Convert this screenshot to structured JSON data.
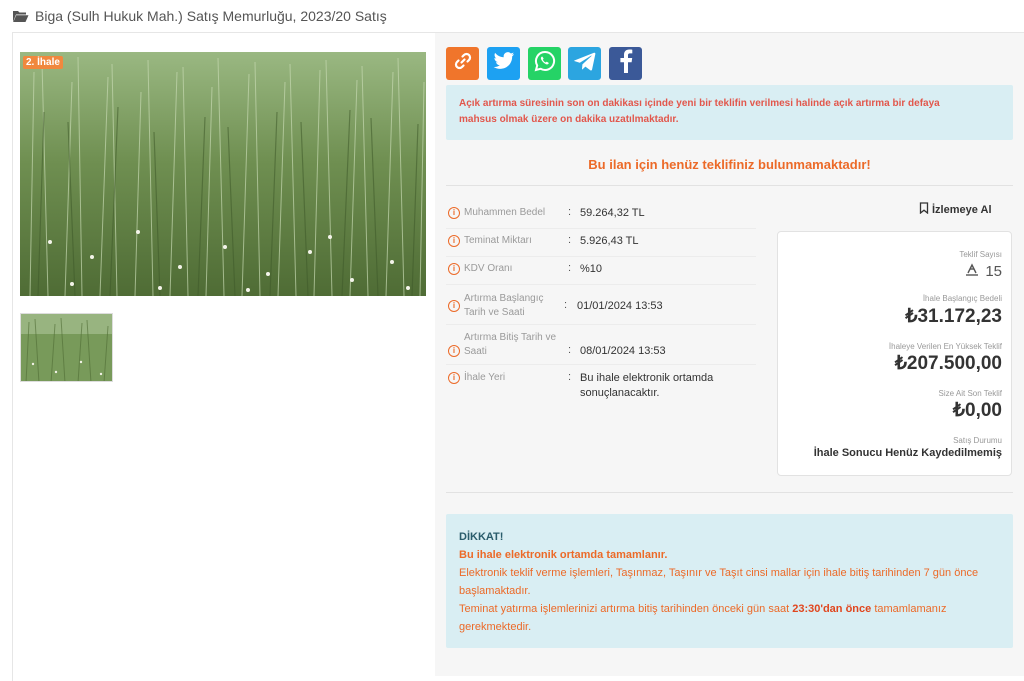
{
  "header": {
    "title": "Biga (Sulh Hukuk Mah.) Satış Memurluğu, 2023/20 Satış",
    "icon": "folder-open-icon"
  },
  "gallery": {
    "badge": "2. İhale"
  },
  "share": {
    "buttons": [
      {
        "icon": "link-icon",
        "color": "#f0752b"
      },
      {
        "icon": "twitter-icon",
        "color": "#1da1f2"
      },
      {
        "icon": "whatsapp-icon",
        "color": "#25d366"
      },
      {
        "icon": "telegram-icon",
        "color": "#2ca5e0"
      },
      {
        "icon": "facebook-icon",
        "color": "#3b5998"
      }
    ]
  },
  "notice_top": {
    "line1": "Açık artırma süresinin son on dakikası içinde yeni bir teklifin verilmesi halinde açık artırma bir defaya",
    "line2": "mahsus olmak üzere on dakika uzatılmaktadır."
  },
  "no_bid_message": "Bu ilan için henüz teklifiniz bulunmamaktadır!",
  "info": [
    {
      "label": "Muhammen Bedel",
      "value": "59.264,32 TL"
    },
    {
      "label": "Teminat Miktarı",
      "value": "5.926,43 TL"
    },
    {
      "label": "KDV Oranı",
      "value": "%10"
    },
    {
      "label_line1": "Artırma Başlangıç",
      "label_line2": "Tarih ve Saati",
      "value": "01/01/2024 13:53"
    },
    {
      "label_line1": "Artırma Bitiş Tarih ve",
      "label_line2": "Saati",
      "value": "08/01/2024 13:53"
    },
    {
      "label": "İhale Yeri",
      "value_line1": "Bu ihale elektronik ortamda",
      "value_line2": "sonuçlanacaktır."
    }
  ],
  "watch": {
    "label": "İzlemeye Al",
    "icon": "bookmark-icon"
  },
  "stats": {
    "bid_count_label": "Teklif Sayısı",
    "bid_count": "15",
    "start_price_label": "İhale Başlangıç Bedeli",
    "start_price": "₺31.172,23",
    "highest_bid_label": "İhaleye Verilen En Yüksek Teklif",
    "highest_bid": "₺207.500,00",
    "your_bid_label": "Size Ait Son Teklif",
    "your_bid": "₺0,00",
    "status_label": "Satış Durumu",
    "status": "İhale Sonucu Henüz Kaydedilmemiş"
  },
  "notice_bottom": {
    "title": "DİKKAT!",
    "line1": "Bu ihale elektronik ortamda tamamlanır.",
    "line2a": "Elektronik teklif verme işlemleri, Taşınmaz, Taşınır ve Taşıt cinsi mallar için ihale bitiş tarihinden 7 gün önce",
    "line2b": "başlamaktadır.",
    "line3a": "Teminat yatırma işlemlerinizi artırma bitiş tarihinden önceki gün saat",
    "line3time": "23:30'dan önce",
    "line3b": "tamamlamanız",
    "line3c": "gerekmektedir."
  },
  "colors": {
    "accent": "#ec6a28",
    "notice_bg": "#d9eef3",
    "warning_text": "#e2574c"
  }
}
